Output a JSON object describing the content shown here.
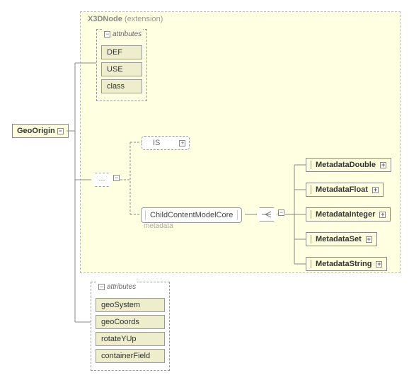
{
  "rootNode": {
    "label": "GeoOrigin"
  },
  "extension": {
    "title_bold": "X3DNode",
    "title_rest": " (extension)"
  },
  "topAttributes": {
    "heading": "attributes",
    "items": [
      "DEF",
      "USE",
      "class"
    ]
  },
  "isNode": {
    "label": "IS"
  },
  "sequenceDots": "•••",
  "childContent": {
    "label": "ChildContentModelCore",
    "caption": "metadata"
  },
  "metadataNodes": [
    "MetadataDouble",
    "MetadataFloat",
    "MetadataInteger",
    "MetadataSet",
    "MetadataString"
  ],
  "bottomAttributes": {
    "heading": "attributes",
    "items": [
      "geoSystem",
      "geoCoords",
      "rotateYUp",
      "containerField"
    ]
  }
}
